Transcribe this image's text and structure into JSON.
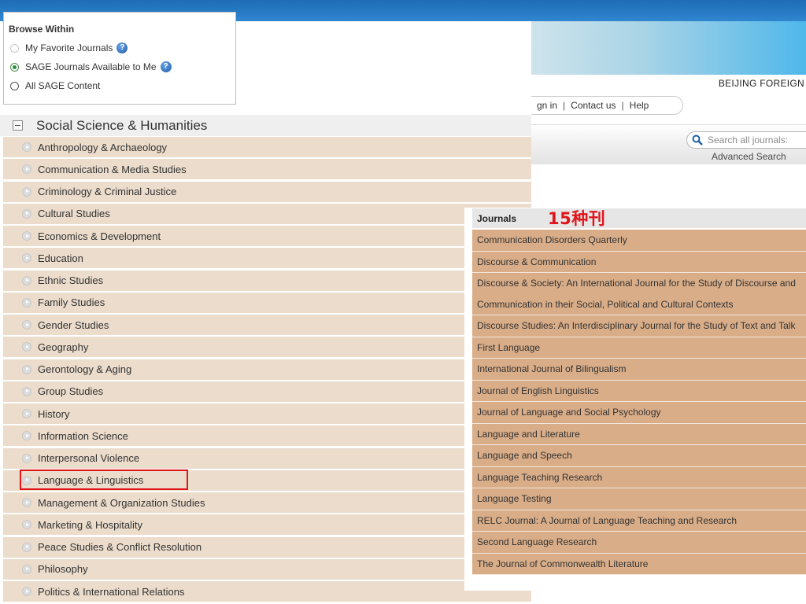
{
  "site": {
    "institution": "BEIJING FOREIGN",
    "util_links": [
      "gn in",
      "Contact us",
      "Help"
    ],
    "search_placeholder": "Search all journals:",
    "advanced_search": "Advanced Search"
  },
  "browse_within": {
    "title": "Browse Within",
    "options": [
      {
        "label": "My Favorite Journals",
        "checked": false
      },
      {
        "label": "SAGE Journals Available to Me",
        "checked": true
      },
      {
        "label": "All SAGE Content",
        "checked": false
      }
    ]
  },
  "categories": {
    "title": "Social Science & Humanities",
    "items": [
      "Anthropology & Archaeology",
      "Communication & Media Studies",
      "Criminology & Criminal Justice",
      "Cultural Studies",
      "Economics & Development",
      "Education",
      "Ethnic Studies",
      "Family Studies",
      "Gender Studies",
      "Geography",
      "Gerontology & Aging",
      "Group Studies",
      "History",
      "Information Science",
      "Interpersonal Violence",
      "Language & Linguistics",
      "Management & Organization Studies",
      "Marketing & Hospitality",
      "Peace Studies & Conflict Resolution",
      "Philosophy",
      "Politics & International Relations"
    ],
    "highlighted": "Language & Linguistics"
  },
  "journals": {
    "title": "Journals",
    "annotation": "15种刊",
    "items": [
      "Communication Disorders Quarterly",
      "Discourse & Communication",
      "Discourse & Society: An International Journal for the Study of Discourse and Communication in their Social, Political and Cultural Contexts",
      "Discourse Studies: An Interdisciplinary Journal for the Study of Text and Talk",
      "First Language",
      "International Journal of Bilingualism",
      "Journal of English Linguistics",
      "Journal of Language and Social Psychology",
      "Language and Literature",
      "Language and Speech",
      "Language Teaching Research",
      "Language Testing",
      "RELC Journal: A Journal of Language Teaching and Research",
      "Second Language Research",
      "The Journal of Commonwealth Literature"
    ]
  }
}
